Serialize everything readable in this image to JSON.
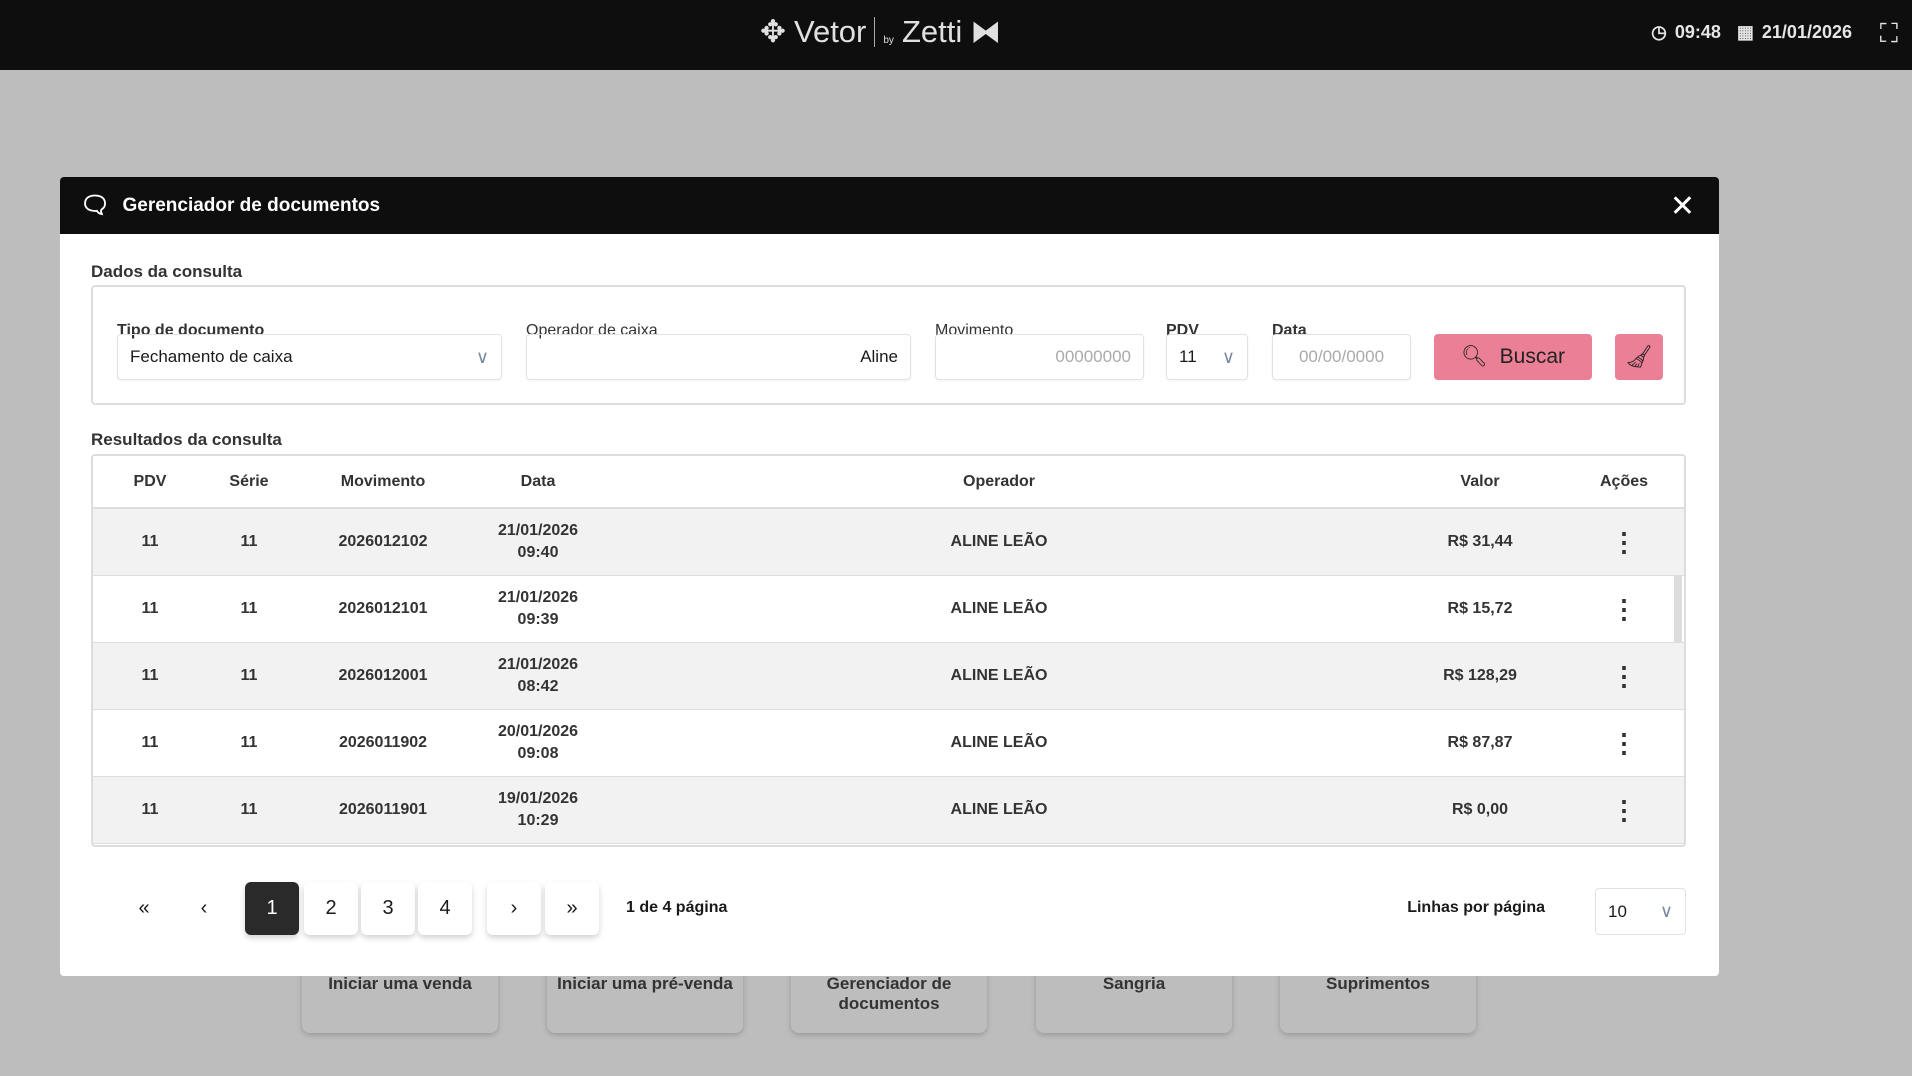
{
  "topbar": {
    "logo_main": "Vetor",
    "logo_by": "by",
    "logo_brand": "Zetti",
    "time": "09:48",
    "date": "21/01/2026"
  },
  "background_tiles": [
    "Iniciar uma venda",
    "Iniciar uma pré-venda",
    "Gerenciador de documentos",
    "Sangria",
    "Suprimentos"
  ],
  "modal": {
    "title": "Gerenciador de documentos",
    "query_section": "Dados da consulta",
    "filters": {
      "tipo_label": "Tipo de documento",
      "tipo_value": "Fechamento de caixa",
      "operador_label": "Operador de caixa",
      "operador_value": "Aline",
      "movimento_label": "Movimento",
      "movimento_placeholder": "00000000",
      "pdv_label": "PDV",
      "pdv_value": "11",
      "data_label": "Data",
      "data_placeholder": "00/00/0000",
      "buscar_label": "Buscar"
    },
    "results_section": "Resultados da consulta",
    "columns": [
      "PDV",
      "Série",
      "Movimento",
      "Data",
      "Operador",
      "Valor",
      "Ações"
    ],
    "rows": [
      {
        "pdv": "11",
        "serie": "11",
        "movimento": "2026012102",
        "data": "21/01/2026",
        "hora": "09:40",
        "operador": "ALINE LEÃO",
        "valor": "R$ 31,44"
      },
      {
        "pdv": "11",
        "serie": "11",
        "movimento": "2026012101",
        "data": "21/01/2026",
        "hora": "09:39",
        "operador": "ALINE LEÃO",
        "valor": "R$ 15,72"
      },
      {
        "pdv": "11",
        "serie": "11",
        "movimento": "2026012001",
        "data": "21/01/2026",
        "hora": "08:42",
        "operador": "ALINE LEÃO",
        "valor": "R$ 128,29"
      },
      {
        "pdv": "11",
        "serie": "11",
        "movimento": "2026011902",
        "data": "20/01/2026",
        "hora": "09:08",
        "operador": "ALINE LEÃO",
        "valor": "R$ 87,87"
      },
      {
        "pdv": "11",
        "serie": "11",
        "movimento": "2026011901",
        "data": "19/01/2026",
        "hora": "10:29",
        "operador": "ALINE LEÃO",
        "valor": "R$ 0,00"
      }
    ],
    "pagination": {
      "pages": [
        "1",
        "2",
        "3",
        "4"
      ],
      "current": "1",
      "info": "1 de 4 página",
      "rows_label": "Linhas por página",
      "rows_value": "10"
    }
  }
}
